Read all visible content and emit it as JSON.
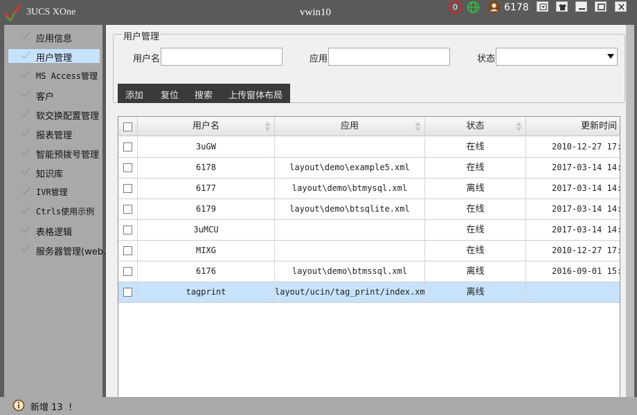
{
  "window": {
    "app_title": "3UCS XOne",
    "title": "vwin10",
    "notification_count": "0",
    "user_id": "6178"
  },
  "sidebar": {
    "items": [
      {
        "label": "应用信息",
        "icon": "check-icon"
      },
      {
        "label": "用户管理",
        "icon": "check-icon",
        "active": true
      },
      {
        "label": "MS Access管理",
        "icon": "check-icon"
      },
      {
        "label": "客户",
        "icon": "check-icon"
      },
      {
        "label": "软交换配置管理",
        "icon": "check-icon"
      },
      {
        "label": "报表管理",
        "icon": "check-icon"
      },
      {
        "label": "智能预拨号管理",
        "icon": "check-icon"
      },
      {
        "label": "知识库",
        "icon": "check-icon"
      },
      {
        "label": "IVR管理",
        "icon": "check-icon"
      },
      {
        "label": "Ctrls使用示例",
        "icon": "check-icon"
      },
      {
        "label": "表格逻辑",
        "icon": "check-icon"
      },
      {
        "label": "服务器管理(web.",
        "icon": "check-icon"
      }
    ]
  },
  "filter": {
    "legend": "用户管理",
    "username_label": "用户名",
    "username_value": "",
    "app_label": "应用",
    "app_value": "",
    "status_label": "状态",
    "status_value": ""
  },
  "toolbar": {
    "add": "添加",
    "reset": "复位",
    "search": "搜索",
    "upload_layout": "上传窗体布局"
  },
  "table": {
    "columns": [
      "用户名",
      "应用",
      "状态",
      "更新时间"
    ],
    "rows": [
      {
        "username": "3uGW",
        "app": "",
        "status": "在线",
        "updated": "2010-12-27 17:",
        "selected": false
      },
      {
        "username": "6178",
        "app": "layout\\demo\\example5.xml",
        "status": "在线",
        "updated": "2017-03-14 14:",
        "selected": false
      },
      {
        "username": "6177",
        "app": "layout\\demo\\btmysql.xml",
        "status": "离线",
        "updated": "2017-03-14 14:",
        "selected": false
      },
      {
        "username": "6179",
        "app": "layout\\demo\\btsqlite.xml",
        "status": "在线",
        "updated": "2017-03-14 14:",
        "selected": false
      },
      {
        "username": "3uMCU",
        "app": "",
        "status": "在线",
        "updated": "2017-03-14 14:",
        "selected": false
      },
      {
        "username": "MIXG",
        "app": "",
        "status": "在线",
        "updated": "2010-12-27 17:",
        "selected": false
      },
      {
        "username": "6176",
        "app": "layout\\demo\\btmssql.xml",
        "status": "离线",
        "updated": "2016-09-01 15:",
        "selected": false
      },
      {
        "username": "tagprint",
        "app": "layout/ucin/tag_print/index.xml",
        "status": "离线",
        "updated": "",
        "selected": true
      }
    ]
  },
  "statusbar": {
    "message": "新增 13  !"
  },
  "colors": {
    "title_bg": "#5a5a5a",
    "sidebar_bg": "#a9a9a9",
    "selection": "#c6e3fb",
    "toolbar_bg": "#3a3a3a"
  }
}
